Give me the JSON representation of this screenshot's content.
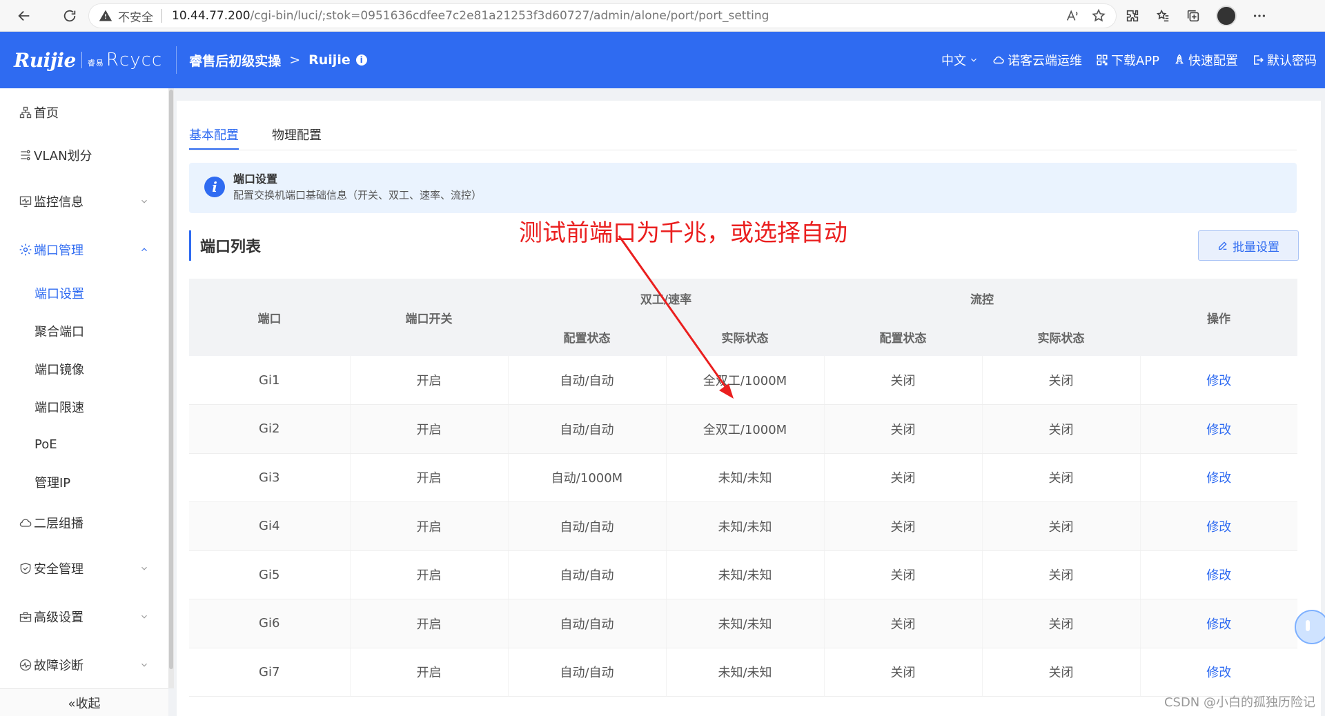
{
  "browser": {
    "insecure_label": "不安全",
    "url_host": "10.44.77.200",
    "url_path": "/cgi-bin/luci/;stok=0951636cdfee7c2e81a21253f3d60727/admin/alone/port/port_setting"
  },
  "header": {
    "logo_main": "Ruijie",
    "logo_sub_prefix": "睿易",
    "logo_sub": "Rcycc",
    "breadcrumb_1": "睿售后初级实操",
    "breadcrumb_2": "Ruijie",
    "lang": "中文",
    "cloud": "诺客云端运维",
    "download": "下载APP",
    "quick": "快速配置",
    "password": "默认密码"
  },
  "sidebar": {
    "home": "首页",
    "vlan": "VLAN划分",
    "monitor": "监控信息",
    "port_mgmt": "端口管理",
    "sub": {
      "port_setting": "端口设置",
      "aggregate": "聚合端口",
      "mirror": "端口镜像",
      "rate_limit": "端口限速",
      "poe": "PoE",
      "mgmt_ip": "管理IP"
    },
    "l2_multicast": "二层组播",
    "security": "安全管理",
    "advanced": "高级设置",
    "diagnosis": "故障诊断",
    "collapse": "«收起"
  },
  "tabs": {
    "basic": "基本配置",
    "physical": "物理配置"
  },
  "notice": {
    "title": "端口设置",
    "desc": "配置交换机端口基础信息（开关、双工、速率、流控）"
  },
  "section": {
    "title": "端口列表",
    "batch_button": "批量设置"
  },
  "table": {
    "headers": {
      "port": "端口",
      "switch": "端口开关",
      "duplex_speed": "双工/速率",
      "flow": "流控",
      "action": "操作",
      "config_state": "配置状态",
      "actual_state": "实际状态",
      "flow_config": "配置状态",
      "flow_actual": "实际状态"
    },
    "rows": [
      {
        "port": "Gi1",
        "switch": "开启",
        "duplex_config": "自动/自动",
        "duplex_actual": "全双工/1000M",
        "flow_config": "关闭",
        "flow_actual": "关闭",
        "action": "修改"
      },
      {
        "port": "Gi2",
        "switch": "开启",
        "duplex_config": "自动/自动",
        "duplex_actual": "全双工/1000M",
        "flow_config": "关闭",
        "flow_actual": "关闭",
        "action": "修改"
      },
      {
        "port": "Gi3",
        "switch": "开启",
        "duplex_config": "自动/1000M",
        "duplex_actual": "未知/未知",
        "flow_config": "关闭",
        "flow_actual": "关闭",
        "action": "修改"
      },
      {
        "port": "Gi4",
        "switch": "开启",
        "duplex_config": "自动/自动",
        "duplex_actual": "未知/未知",
        "flow_config": "关闭",
        "flow_actual": "关闭",
        "action": "修改"
      },
      {
        "port": "Gi5",
        "switch": "开启",
        "duplex_config": "自动/自动",
        "duplex_actual": "未知/未知",
        "flow_config": "关闭",
        "flow_actual": "关闭",
        "action": "修改"
      },
      {
        "port": "Gi6",
        "switch": "开启",
        "duplex_config": "自动/自动",
        "duplex_actual": "未知/未知",
        "flow_config": "关闭",
        "flow_actual": "关闭",
        "action": "修改"
      },
      {
        "port": "Gi7",
        "switch": "开启",
        "duplex_config": "自动/自动",
        "duplex_actual": "未知/未知",
        "flow_config": "关闭",
        "flow_actual": "关闭",
        "action": "修改"
      }
    ]
  },
  "annotation": "测试前端口为千兆，或选择自动",
  "watermark": "CSDN @小白的孤独历险记",
  "colors": {
    "brand": "#2f6bf1",
    "annotation": "#ea1f1f"
  }
}
